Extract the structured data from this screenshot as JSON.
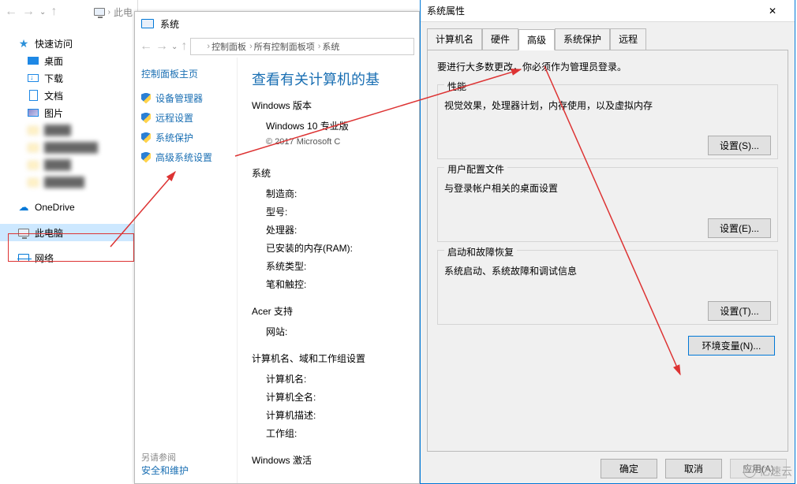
{
  "explorer1": {
    "breadcrumb_pc_label": "此电",
    "quick_access": "快速访问",
    "desktop": "桌面",
    "downloads": "下载",
    "documents": "文档",
    "pictures": "图片",
    "onedrive": "OneDrive",
    "this_pc": "此电脑",
    "network": "网络"
  },
  "explorer2": {
    "window_title": "系统",
    "breadcrumb": {
      "control_panel": "控制面板",
      "all_items": "所有控制面板项",
      "system": "系统"
    },
    "side_header": "控制面板主页",
    "side_links": {
      "device_manager": "设备管理器",
      "remote": "远程设置",
      "protection": "系统保护",
      "advanced": "高级系统设置"
    },
    "main_header": "查看有关计算机的基",
    "windows_version_h": "Windows 版本",
    "windows_version": "Windows 10 专业版",
    "copyright": "© 2017 Microsoft C",
    "system_h": "系统",
    "manufacturer": "制造商:",
    "model": "型号:",
    "processor": "处理器:",
    "ram": "已安装的内存(RAM):",
    "system_type": "系统类型:",
    "pen_touch": "笔和触控:",
    "acer_support": "Acer 支持",
    "site": "网站:",
    "name_h": "计算机名、域和工作组设置",
    "cname": "计算机名:",
    "cfull": "计算机全名:",
    "cdesc": "计算机描述:",
    "workgroup": "工作组:",
    "activation_h": "Windows 激活",
    "see_also": "另请参阅",
    "security": "安全和维护"
  },
  "dialog": {
    "title": "系统属性",
    "tabs": {
      "computer_name": "计算机名",
      "hardware": "硬件",
      "advanced": "高级",
      "protection": "系统保护",
      "remote": "远程"
    },
    "note": "要进行大多数更改，你必须作为管理员登录。",
    "perf": {
      "title": "性能",
      "desc": "视觉效果，处理器计划，内存使用，以及虚拟内存",
      "btn": "设置(S)..."
    },
    "profile": {
      "title": "用户配置文件",
      "desc": "与登录帐户相关的桌面设置",
      "btn": "设置(E)..."
    },
    "startup": {
      "title": "启动和故障恢复",
      "desc": "系统启动、系统故障和调试信息",
      "btn": "设置(T)..."
    },
    "env_btn": "环境变量(N)...",
    "ok": "确定",
    "cancel": "取消",
    "apply": "应用(A)"
  },
  "watermark": "亿速云"
}
